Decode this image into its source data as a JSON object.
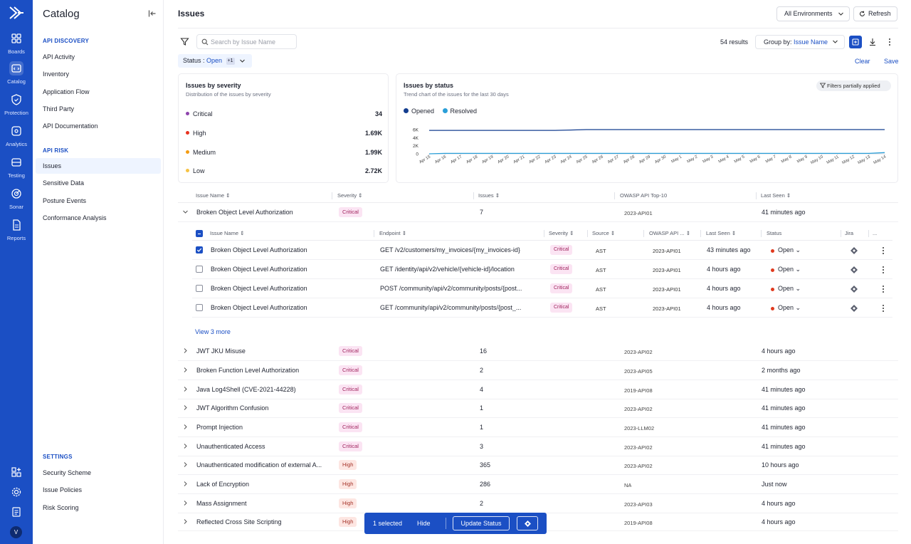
{
  "rail": {
    "items": [
      {
        "label": "Boards",
        "icon": "grid-icon"
      },
      {
        "label": "Catalog",
        "icon": "catalog-icon"
      },
      {
        "label": "Protection",
        "icon": "shield-icon"
      },
      {
        "label": "Analytics",
        "icon": "analytics-icon"
      },
      {
        "label": "Testing",
        "icon": "testing-icon"
      },
      {
        "label": "Sonar",
        "icon": "sonar-icon"
      },
      {
        "label": "Reports",
        "icon": "reports-icon"
      }
    ],
    "avatar": "V"
  },
  "sidebar": {
    "title": "Catalog",
    "api_discovery_label": "API DISCOVERY",
    "api_discovery": [
      "API Activity",
      "Inventory",
      "Application Flow",
      "Third Party",
      "API Documentation"
    ],
    "api_risk_label": "API RISK",
    "api_risk": [
      "Issues",
      "Sensitive Data",
      "Posture Events",
      "Conformance Analysis"
    ],
    "settings_label": "SETTINGS",
    "settings": [
      "Security Scheme",
      "Issue Policies",
      "Risk Scoring"
    ]
  },
  "header": {
    "title": "Issues",
    "environment": "All Environments",
    "refresh": "Refresh"
  },
  "toolbar": {
    "search_placeholder": "Search by Issue Name",
    "results": "54 results",
    "group_by_label": "Group by:",
    "group_by_value": "Issue Name",
    "status_label": "Status :",
    "status_value": "Open",
    "status_more": "+1",
    "clear": "Clear",
    "save": "Save"
  },
  "severity_card": {
    "title": "Issues by severity",
    "subtitle": "Distribution of the issues by severity",
    "rows": [
      {
        "label": "Critical",
        "value": "34",
        "color": "#8e44ad"
      },
      {
        "label": "High",
        "value": "1.69K",
        "color": "#e8321f"
      },
      {
        "label": "Medium",
        "value": "1.99K",
        "color": "#f39c12"
      },
      {
        "label": "Low",
        "value": "2.72K",
        "color": "#f6c344"
      }
    ]
  },
  "status_card": {
    "title": "Issues by status",
    "subtitle": "Trend chart of the issues for the last 30 days",
    "filters_chip": "Filters partially applied",
    "legend": [
      {
        "label": "Opened",
        "color": "#133d8f"
      },
      {
        "label": "Resolved",
        "color": "#2a9fd8"
      }
    ]
  },
  "chart_data": {
    "type": "line",
    "x": [
      "Apr 15",
      "Apr 16",
      "Apr 17",
      "Apr 18",
      "Apr 19",
      "Apr 20",
      "Apr 21",
      "Apr 22",
      "Apr 23",
      "Apr 24",
      "Apr 25",
      "Apr 26",
      "Apr 27",
      "Apr 28",
      "Apr 29",
      "Apr 30",
      "May 1",
      "May 2",
      "May 3",
      "May 4",
      "May 5",
      "May 6",
      "May 7",
      "May 8",
      "May 9",
      "May 10",
      "May 11",
      "May 12",
      "May 13",
      "May 14"
    ],
    "y_ticks": [
      "6K",
      "4K",
      "2K",
      "0"
    ],
    "ylim": [
      0,
      6000
    ],
    "series": [
      {
        "name": "Opened",
        "values": [
          5800,
          5800,
          5800,
          5800,
          5800,
          5800,
          5800,
          5800,
          5800,
          5900,
          6000,
          6000,
          6000,
          6000,
          6000,
          6000,
          6000,
          6000,
          6000,
          6000,
          6000,
          6000,
          6000,
          6000,
          6000,
          6000,
          6000,
          6000,
          6000,
          6000
        ]
      },
      {
        "name": "Resolved",
        "values": [
          0,
          100,
          100,
          100,
          100,
          100,
          100,
          100,
          100,
          100,
          100,
          100,
          100,
          100,
          100,
          100,
          100,
          100,
          100,
          100,
          100,
          100,
          100,
          100,
          100,
          100,
          100,
          100,
          100,
          300
        ]
      }
    ]
  },
  "table": {
    "columns": [
      "Issue Name",
      "Severity",
      "Issues",
      "OWASP API Top-10",
      "Last Seen"
    ],
    "expanded": {
      "name": "Broken Object Level Authorization",
      "severity": "Critical",
      "issues": "7",
      "owasp": "2023-API01",
      "last_seen": "41 minutes ago"
    },
    "sub_columns": [
      "Issue Name",
      "Endpoint",
      "Severity",
      "Source",
      "OWASP API ...",
      "Last Seen",
      "Status",
      "Jira",
      "..."
    ],
    "sub_rows": [
      {
        "name": "Broken Object Level Authorization",
        "endpoint": "GET /v2/customers/my_invoices/{my_invoices-id}",
        "severity": "Critical",
        "source": "AST",
        "owasp": "2023-API01",
        "last_seen": "43 minutes ago",
        "status": "Open",
        "checked": true
      },
      {
        "name": "Broken Object Level Authorization",
        "endpoint": "GET /identity/api/v2/vehicle/{vehicle-id}/location",
        "severity": "Critical",
        "source": "AST",
        "owasp": "2023-API01",
        "last_seen": "4 hours ago",
        "status": "Open",
        "checked": false
      },
      {
        "name": "Broken Object Level Authorization",
        "endpoint": "POST /community/api/v2/community/posts/{post...",
        "severity": "Critical",
        "source": "AST",
        "owasp": "2023-API01",
        "last_seen": "4 hours ago",
        "status": "Open",
        "checked": false
      },
      {
        "name": "Broken Object Level Authorization",
        "endpoint": "GET /community/api/v2/community/posts/{post_...",
        "severity": "Critical",
        "source": "AST",
        "owasp": "2023-API01",
        "last_seen": "4 hours ago",
        "status": "Open",
        "checked": false
      }
    ],
    "view_more": "View 3 more",
    "rows": [
      {
        "name": "JWT JKU Misuse",
        "severity": "Critical",
        "issues": "16",
        "owasp": "2023-API02",
        "last_seen": "4 hours ago"
      },
      {
        "name": "Broken Function Level Authorization",
        "severity": "Critical",
        "issues": "2",
        "owasp": "2023-API05",
        "last_seen": "2 months ago"
      },
      {
        "name": "Java Log4Shell (CVE-2021-44228)",
        "severity": "Critical",
        "issues": "4",
        "owasp": "2019-API08",
        "last_seen": "41 minutes ago"
      },
      {
        "name": "JWT Algorithm Confusion",
        "severity": "Critical",
        "issues": "1",
        "owasp": "2023-API02",
        "last_seen": "41 minutes ago"
      },
      {
        "name": "Prompt Injection",
        "severity": "Critical",
        "issues": "1",
        "owasp": "2023-LLM02",
        "last_seen": "41 minutes ago"
      },
      {
        "name": "Unauthenticated Access",
        "severity": "Critical",
        "issues": "3",
        "owasp": "2023-API02",
        "last_seen": "41 minutes ago"
      },
      {
        "name": "Unauthenticated modification of external A...",
        "severity": "High",
        "issues": "365",
        "owasp": "2023-API02",
        "last_seen": "10 hours ago"
      },
      {
        "name": "Lack of Encryption",
        "severity": "High",
        "issues": "286",
        "owasp": "NA",
        "last_seen": "Just now"
      },
      {
        "name": "Mass Assignment",
        "severity": "High",
        "issues": "2",
        "owasp": "2023-API03",
        "last_seen": "4 hours ago"
      },
      {
        "name": "Reflected Cross Site Scripting",
        "severity": "High",
        "issues": "",
        "owasp": "2019-API08",
        "last_seen": "4 hours ago"
      }
    ]
  },
  "action_bar": {
    "selected": "1 selected",
    "hide": "Hide",
    "update_status": "Update Status"
  },
  "colors": {
    "brand": "#1b4fc4",
    "critical_bg": "#fbe4f3",
    "high_bg": "#fde6e2",
    "status_open": "#e03a1e"
  }
}
